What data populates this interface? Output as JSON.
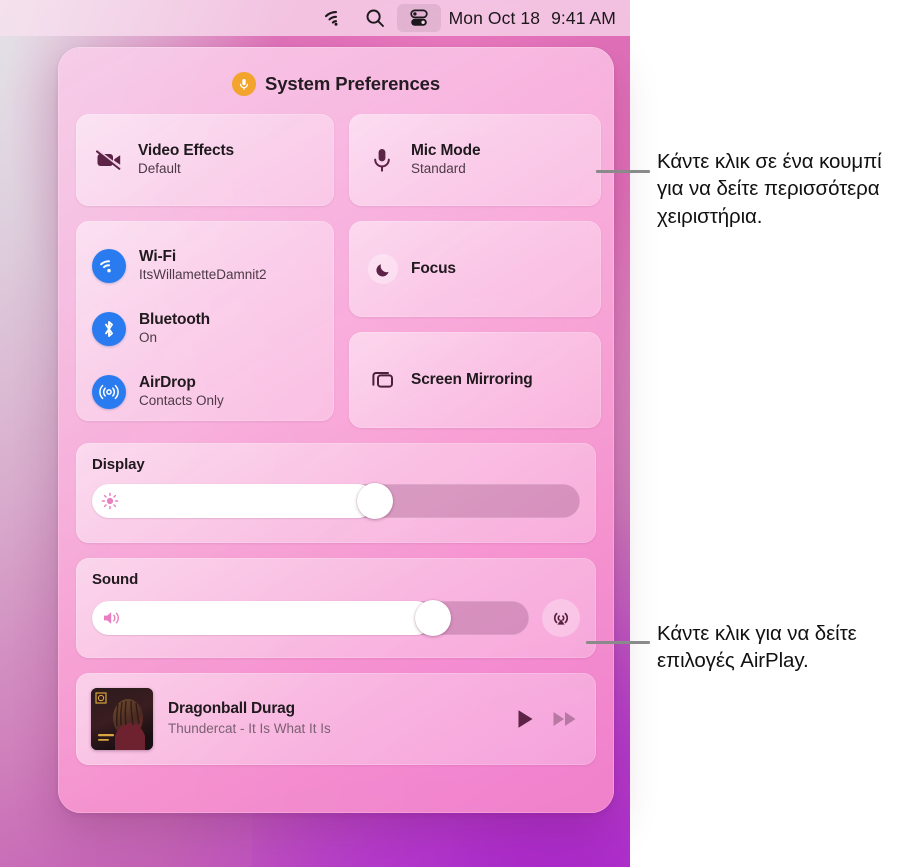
{
  "menubar": {
    "icons": [
      {
        "name": "wifi-icon",
        "label": "Wi-Fi"
      },
      {
        "name": "search-icon",
        "label": "Spotlight Search"
      },
      {
        "name": "control-center-icon",
        "label": "Control Center"
      }
    ],
    "date": "Mon Oct 18",
    "time": "9:41 AM"
  },
  "panel": {
    "header": {
      "icon": "microphone-icon",
      "icon_color": "#f2a42c",
      "title": "System Preferences"
    },
    "video_effects": {
      "icon": "video-off-icon",
      "title": "Video Effects",
      "subtitle": "Default"
    },
    "mic_mode": {
      "icon": "microphone-icon",
      "title": "Mic Mode",
      "subtitle": "Standard"
    },
    "connectivity": [
      {
        "icon": "wifi-icon",
        "title": "Wi-Fi",
        "subtitle": "ItsWillametteDamnit2",
        "icon_color": "#2a7bf0",
        "active": true
      },
      {
        "icon": "bluetooth-icon",
        "title": "Bluetooth",
        "subtitle": "On",
        "icon_color": "#2a7bf0",
        "active": true
      },
      {
        "icon": "airdrop-icon",
        "title": "AirDrop",
        "subtitle": "Contacts Only",
        "icon_color": "#2a7bf0",
        "active": true
      }
    ],
    "focus": {
      "icon": "moon-icon",
      "label": "Focus"
    },
    "screen_mirroring": {
      "icon": "screen-mirroring-icon",
      "label": "Screen Mirroring"
    },
    "display": {
      "heading": "Display",
      "icon": "brightness-icon",
      "value_percent": 58
    },
    "sound": {
      "heading": "Sound",
      "icon": "speaker-icon",
      "value_percent": 78,
      "airplay_icon": "airplay-audio-icon"
    },
    "now_playing": {
      "album_art": "album-artwork",
      "track": "Dragonball Durag",
      "artist_album": "Thundercat - It Is What It Is",
      "play_icon": "play-icon",
      "forward_icon": "fast-forward-icon"
    }
  },
  "callouts": [
    {
      "id": "callout-controls",
      "text": "Κάντε κλικ σε ένα κουμπί για να δείτε περισσότερα χειριστήρια."
    },
    {
      "id": "callout-airplay",
      "text": "Κάντε κλικ για να δείτε επιλογές AirPlay."
    }
  ],
  "colors": {
    "accent_blue": "#2a7bf0",
    "mic_orange": "#f2a42c",
    "panel_pink": "#f6a0d0",
    "glyph_plum": "#5c2347",
    "leader_gray": "#8a8a8a"
  }
}
